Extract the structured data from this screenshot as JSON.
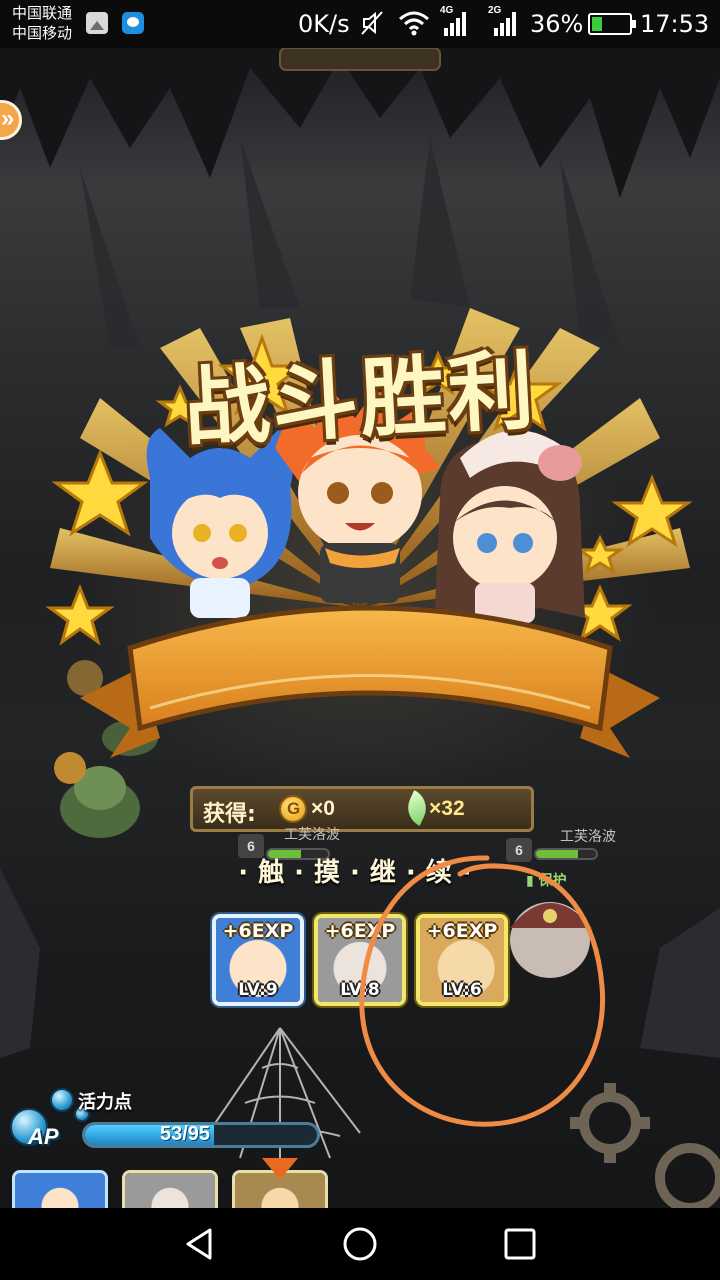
{
  "status_bar": {
    "carrier_1": "中国联通",
    "carrier_2": "中国移动",
    "net_speed": "0K/s",
    "net_4g": "4G",
    "net_2g": "2G",
    "battery_percent": "36%",
    "battery_level": 0.36,
    "time": "17:53",
    "icons": [
      "gallery-icon",
      "chat-icon",
      "mute-icon",
      "wifi-icon",
      "signal-4g-icon",
      "signal-2g-icon",
      "battery-charging-icon"
    ]
  },
  "game": {
    "victory_title": "战斗胜利",
    "rewards": {
      "label": "获得:",
      "coins": "×0",
      "feathers": "×32"
    },
    "touch_continue": "·触·摸·继·续·",
    "exp_cards": [
      {
        "exp": "+6EXP",
        "level": "LV:9",
        "portrait": "blue-haired-catgirl",
        "color": "#3f7fd8"
      },
      {
        "exp": "+6EXP",
        "level": "LV:8",
        "portrait": "white-haired-character",
        "color": "#9a9a9a"
      },
      {
        "exp": "+6EXP",
        "level": "LV:6",
        "portrait": "blonde-character",
        "color": "#d9a95c"
      }
    ],
    "enemies": [
      {
        "name": "工芙洛波",
        "level": "6",
        "hp": 0.55
      },
      {
        "name": "工芙洛波",
        "level": "6",
        "hp": 0.7
      }
    ],
    "protect_label": "保护",
    "ap": {
      "label_cn": "活力点",
      "label": "AP",
      "value": "53/95",
      "current": 53,
      "max": 95
    },
    "accent_color": "#f2a23a",
    "annotation_color": "#ef8b45"
  }
}
